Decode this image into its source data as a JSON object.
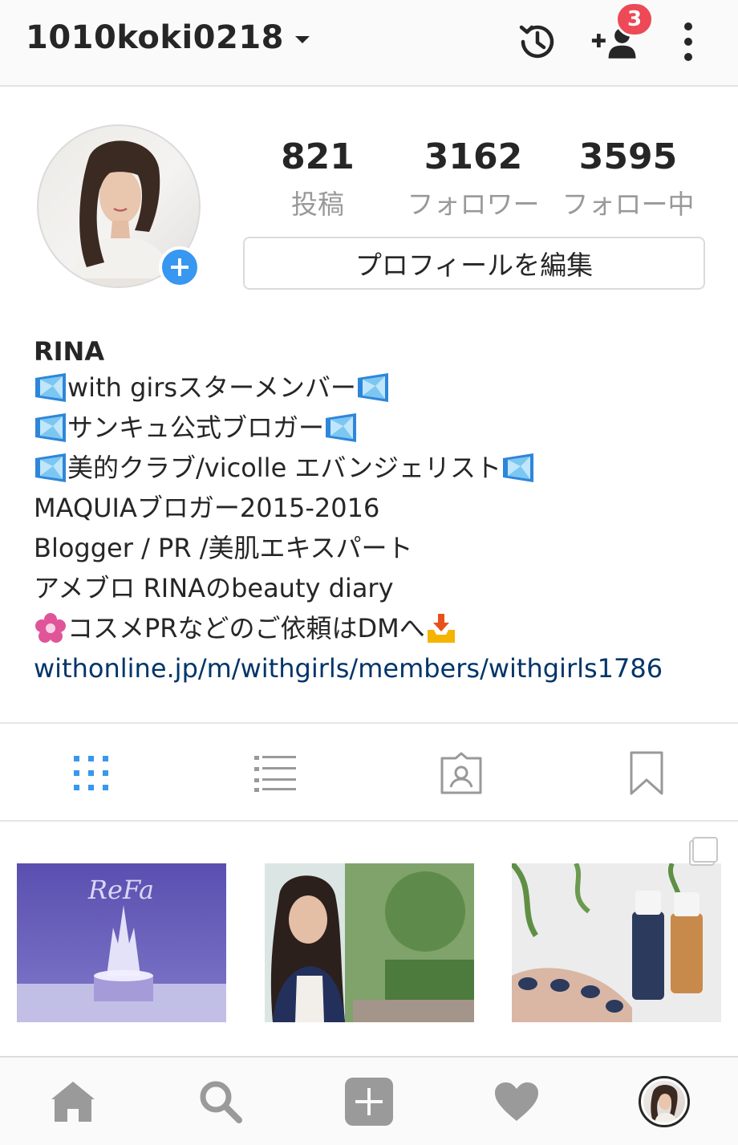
{
  "header": {
    "username": "1010koki0218",
    "notification_count": "3"
  },
  "stats": [
    {
      "value": "821",
      "label": "投稿"
    },
    {
      "value": "3162",
      "label": "フォロワー"
    },
    {
      "value": "3595",
      "label": "フォロー中"
    }
  ],
  "edit_profile_label": "プロフィールを編集",
  "bio": {
    "name": "RINA",
    "lines": [
      "with girsスターメンバー",
      "サンキュ公式ブロガー",
      "美的クラブ/vicolle エバンジェリスト",
      "MAQUIAブロガー2015-2016",
      "Blogger / PR /美肌エキスパート",
      "アメブロ RINAのbeauty diary",
      "コスメPRなどのご依頼はDMへ"
    ],
    "link": "withonline.jp/m/withgirls/members/withgirls1786"
  },
  "posts": [
    {
      "brand_text": "ReFa"
    },
    {
      "brand_text": ""
    },
    {
      "brand_text": ""
    }
  ],
  "colors": {
    "accent": "#3897f0",
    "badge": "#ed4956",
    "link": "#003569",
    "icon_gray": "#999999"
  },
  "icons": {
    "header": [
      "history-icon",
      "add-user-icon",
      "more-options-icon"
    ],
    "tabs": [
      "grid-icon",
      "list-icon",
      "tagged-icon",
      "saved-icon"
    ],
    "nav": [
      "home-icon",
      "search-icon",
      "new-post-icon",
      "activity-heart-icon",
      "profile-avatar"
    ]
  }
}
